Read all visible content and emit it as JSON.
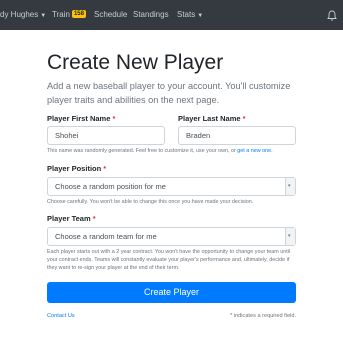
{
  "nav": {
    "user_label": "dy Hughes",
    "train_label": "Train",
    "train_badge": "158",
    "schedule_label": "Schedule",
    "standings_label": "Standings",
    "stats_label": "Stats",
    "caret": "▼"
  },
  "page": {
    "title": "Create New Player",
    "lead": "Add a new baseball player to your account. You'll customize player traits and abilities on the next page."
  },
  "form": {
    "required_mark": "*",
    "first_name": {
      "label": "Player First Name",
      "value": "Shohei"
    },
    "last_name": {
      "label": "Player Last Name",
      "value": "Braden"
    },
    "name_help": "This name was randomly generated. Feel free to customize it, use your own, or",
    "name_help_link": "get a new one.",
    "position": {
      "label": "Player Position",
      "selected": "Choose a random position for me",
      "help": "Choose carefully. You won't be able to change this once you have made your decision."
    },
    "team": {
      "label": "Player Team",
      "selected": "Choose a random team for me",
      "help": "Each player starts out with a 2 year contract. You won't have the opportunity to change your team until your contract ends. Teams will constantly evaluate your player's performance and, ultimately, decide if they want to re-sign your player at the end of their term."
    },
    "submit_label": "Create Player"
  },
  "footer": {
    "contact_label": "Contact Us",
    "required_note": "* indicates a required field."
  },
  "colors": {
    "navbar": "#343a40",
    "primary": "#007bff",
    "badge": "#ffc107",
    "required": "#dc3545"
  }
}
